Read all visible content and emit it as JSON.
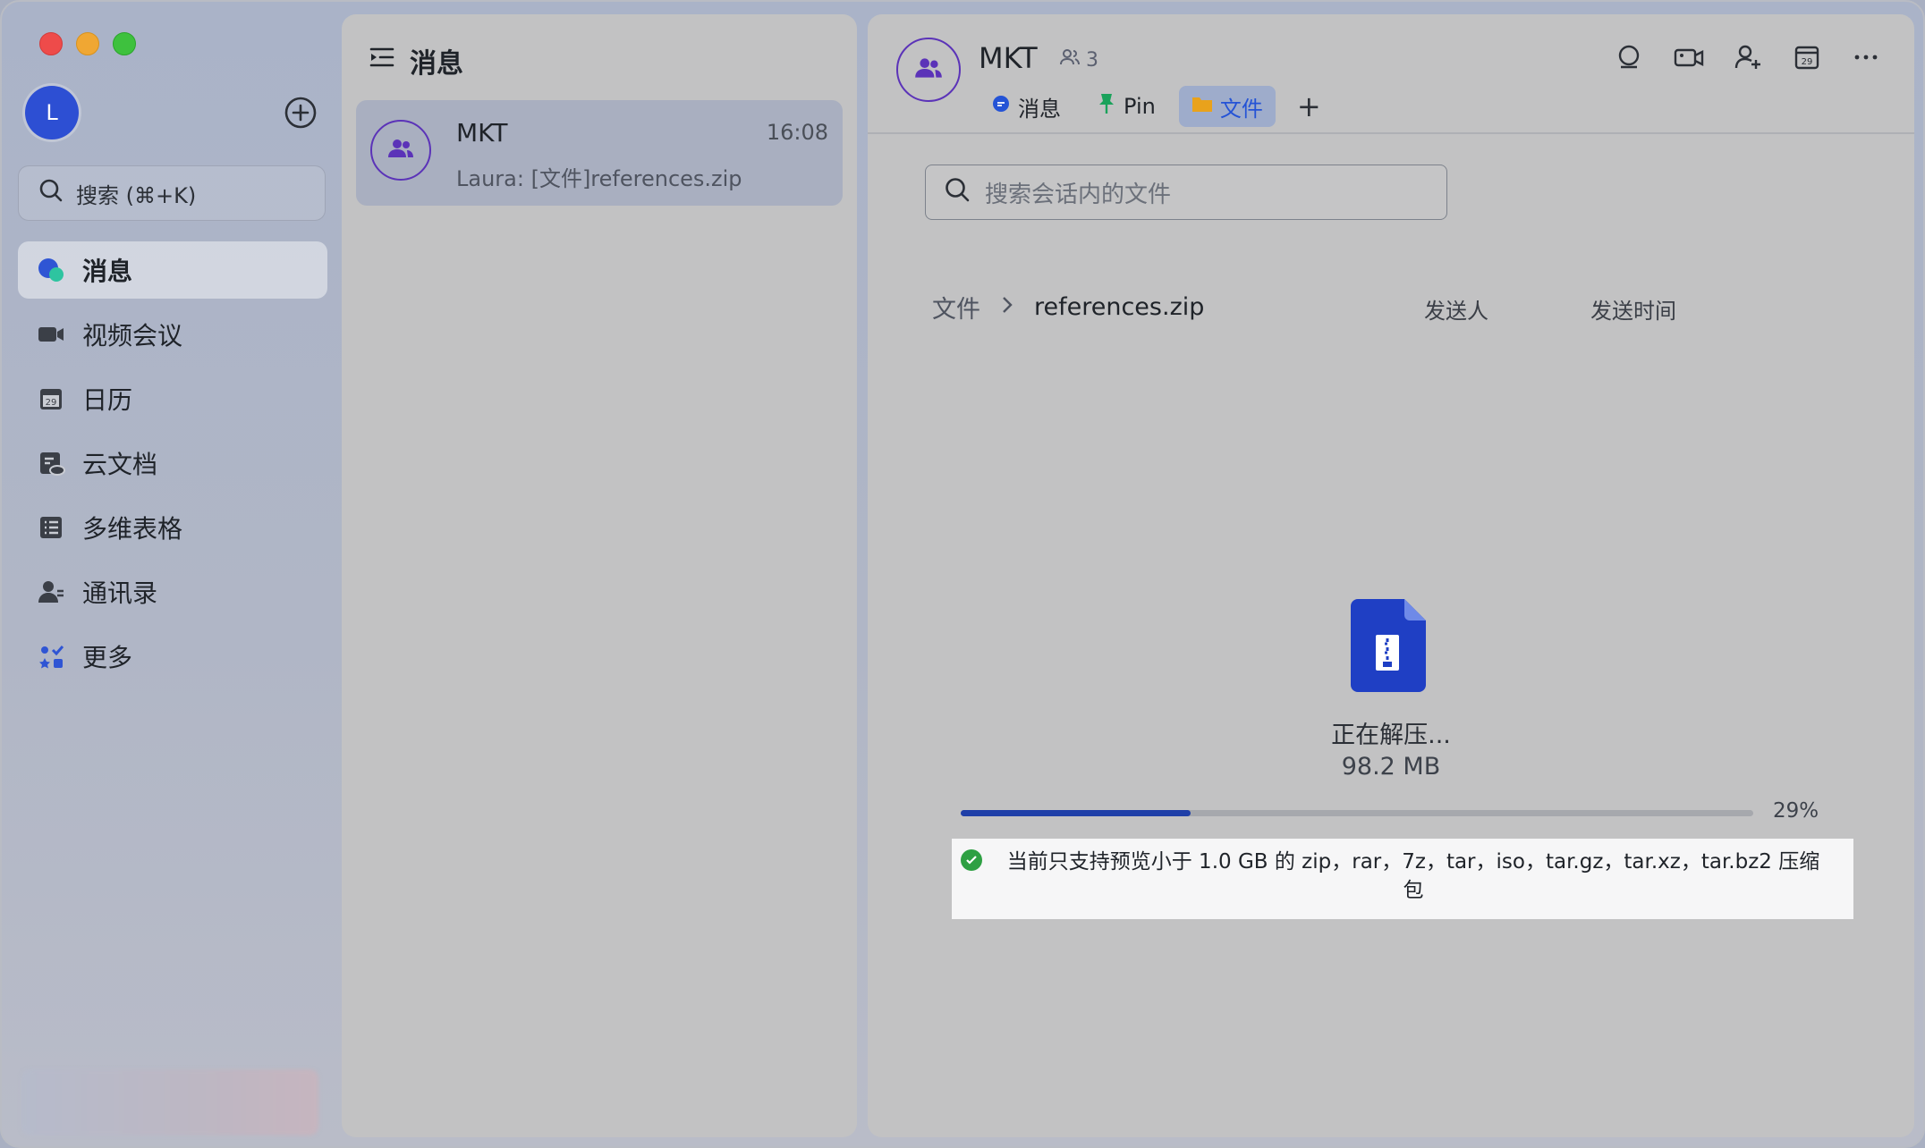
{
  "sidebar": {
    "avatar_initial": "L",
    "search_placeholder": "搜索 (⌘+K)",
    "items": [
      {
        "label": "消息",
        "icon": "chat-bubble-icon"
      },
      {
        "label": "视频会议",
        "icon": "video-icon"
      },
      {
        "label": "日历",
        "icon": "calendar-icon"
      },
      {
        "label": "云文档",
        "icon": "cloud-doc-icon"
      },
      {
        "label": "多维表格",
        "icon": "table-icon"
      },
      {
        "label": "通讯录",
        "icon": "contacts-icon"
      },
      {
        "label": "更多",
        "icon": "more-apps-icon"
      }
    ]
  },
  "chat_list": {
    "title": "消息",
    "items": [
      {
        "name": "MKT",
        "time": "16:08",
        "preview": "Laura: [文件]references.zip"
      }
    ]
  },
  "conversation": {
    "title": "MKT",
    "member_count": "3",
    "tabs": [
      {
        "label": "消息"
      },
      {
        "label": "Pin"
      },
      {
        "label": "文件"
      }
    ],
    "file_search_placeholder": "搜索会话内的文件",
    "breadcrumb_root": "文件",
    "breadcrumb_file": "references.zip",
    "col_sender": "发送人",
    "col_time": "发送时间",
    "status": "正在解压...",
    "file_size": "98.2 MB",
    "progress_percent": 29,
    "progress_label": "29%",
    "notice": "当前只支持预览小于 1.0 GB 的 zip，rar，7z，tar，iso，tar.gz，tar.xz，tar.bz2 压缩包"
  },
  "colors": {
    "accent": "#2453d6",
    "progress": "#1f3fa8",
    "avatar_ring": "#5b33b8",
    "success": "#2ea043"
  }
}
